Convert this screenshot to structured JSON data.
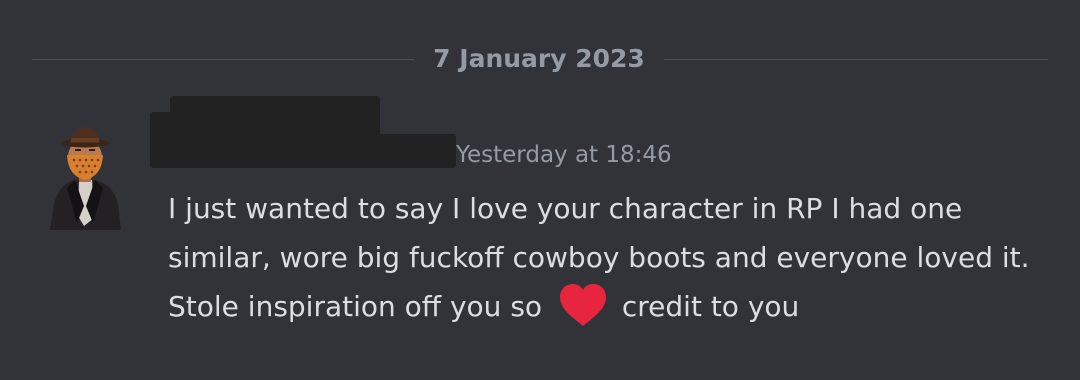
{
  "divider": {
    "date": "7 January 2023"
  },
  "message": {
    "author": "",
    "timestamp": "Yesterday at 18:46",
    "text_before_emoji": "I just wanted to say I love your character in RP I had one similar, wore big fuckoff cowboy boots and everyone loved it. Stole inspiration off you so",
    "emoji": "heart-emoji",
    "text_after_emoji": "credit to you"
  },
  "icons": {
    "avatar": "avatar-cowboy-hat-character",
    "heart": "red-heart-icon"
  },
  "colors": {
    "background": "#313338",
    "text": "#dbdee1",
    "muted": "#949ba4",
    "heart": "#e8253f",
    "redaction": "#222222"
  }
}
